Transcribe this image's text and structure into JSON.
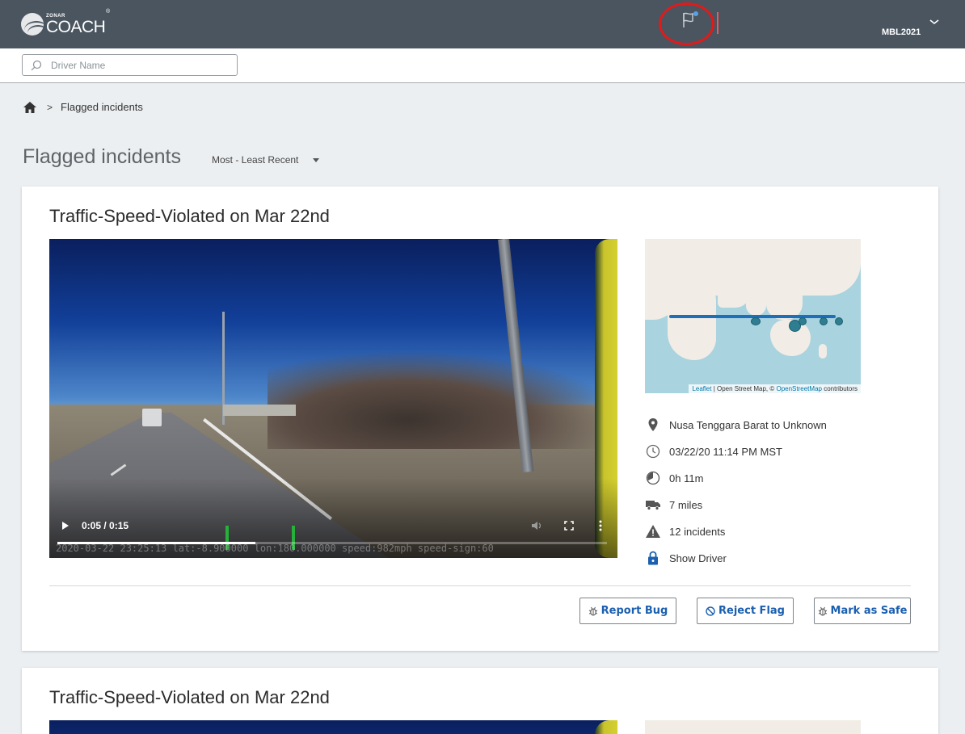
{
  "header": {
    "logo_small": "ZONAR",
    "logo_big": "COACH",
    "logo_reg": "®",
    "user": "MBL2021"
  },
  "search": {
    "placeholder": "Driver Name"
  },
  "breadcrumb": {
    "sep": ">",
    "current": "Flagged incidents"
  },
  "page": {
    "title": "Flagged incidents",
    "sort_label": "Most - Least Recent"
  },
  "incidents": [
    {
      "title": "Traffic-Speed-Violated on Mar 22nd",
      "video": {
        "time": "0:05 / 0:15",
        "progress": 0.36,
        "overlay": "2020-03-22 23:25:13 lat:-8.900000 lon:180.000000 speed:982mph speed-sign:60"
      },
      "map": {
        "attribution_leaflet": "Leaflet",
        "attribution_text": " | Open Street Map, © ",
        "attribution_osm": "OpenStreetMap",
        "attribution_suffix": " contributors"
      },
      "details": {
        "location": "Nusa Tenggara Barat to Unknown",
        "datetime": "03/22/20 11:14 PM MST",
        "duration": "0h 11m",
        "distance": "7 miles",
        "incidents": "12 incidents",
        "driver": "Show Driver"
      },
      "actions": {
        "report": "Report Bug",
        "reject": "Reject Flag",
        "safe": "Mark as Safe"
      }
    },
    {
      "title": "Traffic-Speed-Violated on Mar 22nd"
    }
  ],
  "colors": {
    "topbar": "#4a5560",
    "accent": "#1b5fb0",
    "highlight": "#e21a1a"
  }
}
